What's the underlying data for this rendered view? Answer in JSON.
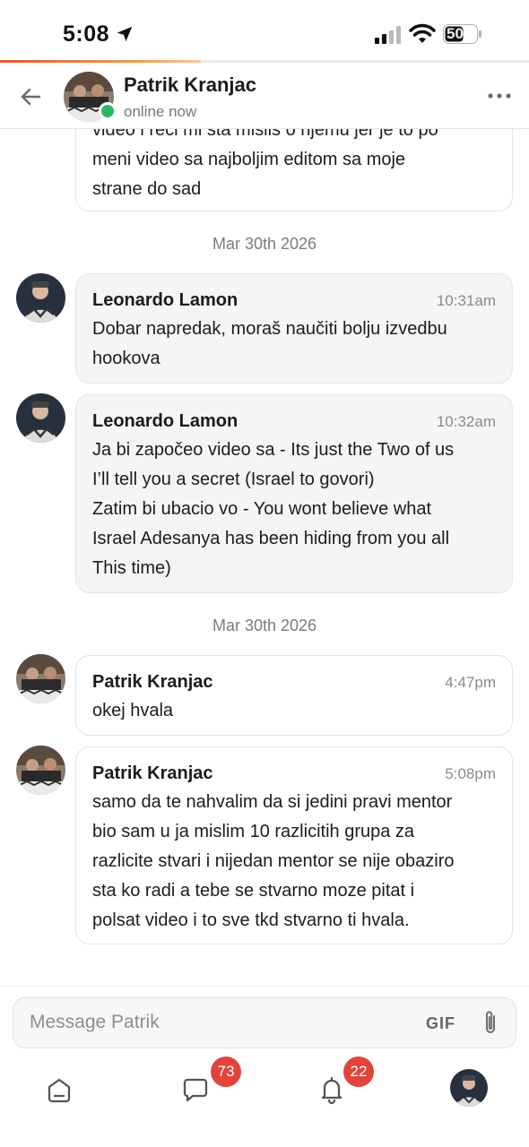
{
  "status_bar": {
    "time": "5:08",
    "battery": "50"
  },
  "header": {
    "contact_name": "Patrik Kranjac",
    "status": "online now"
  },
  "conversation": {
    "partial_message_lines": "video i reci mi sta mislis o njemu jer je to po\nmeni video sa najboljim editom sa moje\nstrane do sad",
    "date_separators": [
      "Mar 30th 2026",
      "Mar 30th 2026"
    ],
    "messages": [
      {
        "sender": "Leonardo Lamon",
        "time": "10:31am",
        "text": "Dobar napredak, moraš naučiti bolju izvedbu\nhookova"
      },
      {
        "sender": "Leonardo Lamon",
        "time": "10:32am",
        "text": "Ja bi započeo video sa - Its just the Two of us\nI’ll tell you a secret (Israel to govori)\nZatim bi ubacio vo - You wont believe what\nIsrael Adesanya has been hiding from you all\nThis time)"
      },
      {
        "sender": "Patrik Kranjac",
        "time": "4:47pm",
        "text": "okej hvala"
      },
      {
        "sender": "Patrik Kranjac",
        "time": "5:08pm",
        "text": "samo da te nahvalim da si jedini pravi mentor\nbio sam u ja mislim 10 razlicitih grupa za\nrazlicite stvari i nijedan mentor se nije obaziro\nsta ko radi a tebe se stvarno moze pitat i\npolsat video i to sve tkd stvarno ti hvala."
      }
    ]
  },
  "composer": {
    "placeholder": "Message Patrik",
    "gif_label": "GIF"
  },
  "bottom_nav": {
    "messages_badge": "73",
    "notifications_badge": "22"
  },
  "colors": {
    "accent": "#e4552f",
    "online": "#2eb664",
    "badge": "#e2433a"
  }
}
